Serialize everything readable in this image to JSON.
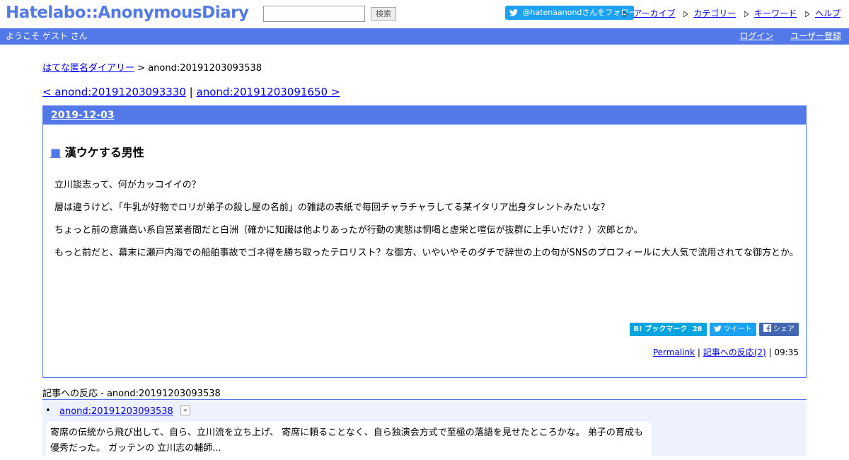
{
  "header": {
    "logo": "Hatelabo::AnonymousDiary",
    "search_placeholder": "",
    "search_button": "検索",
    "follow": "@hatenaanondさんをフォロー",
    "links": [
      "アーカイブ",
      "カテゴリー",
      "キーワード",
      "ヘルプ"
    ]
  },
  "subbar": {
    "welcome": "ようこそ ゲスト さん",
    "login": "ログイン",
    "register": "ユーザー登録"
  },
  "breadcrumb": {
    "home": "はてな匿名ダイアリー",
    "sep": " > ",
    "current": "anond:20191203093538"
  },
  "nav": {
    "prev": "< anond:20191203093330",
    "sep": " | ",
    "next": "anond:20191203091650 >"
  },
  "entry": {
    "date": "2019-12-03",
    "square": "■",
    "title": "漢ウケする男性",
    "paragraphs": [
      "立川談志って、何がカッコイイの？",
      "層は違うけど、「牛乳が好物でロリが弟子の殺し屋の名前」の雑誌の表紙で毎回チャラチャラしてる某イタリア出身タレントみたいな？",
      "ちょっと前の意識高い系自営業者間だと白洲（確かに知識は他よりあったが行動の実態は恫喝と虚栄と喧伝が抜群に上手いだけ？）次郎とか。",
      "もっと前だと、幕末に瀬戸内海での船舶事故でゴネ得を勝ち取ったテロリスト？な御方、いやいやそのダチで辞世の上の句がSNSのプロフィールに大人気で流用されてな御方とか。"
    ],
    "bookmark_label": "B! ブックマーク",
    "bookmark_count": "28",
    "tweet_label": "ツイート",
    "share_label": "シェア",
    "permalink": "Permalink",
    "reactions_link": "記事への反応(2)",
    "time": "09:35"
  },
  "reactions": {
    "header": "記事への反応 - anond:20191203093538",
    "item_link": "anond:20191203093538",
    "quote": "寄席の伝統から飛び出して、自ら、立川流を立ち上げ、 寄席に頼ることなく、自ら独演会方式で至極の落語を見せたところかな。 弟子の育成も優秀だった。 ガッテンの 立川志の輔師..."
  },
  "colors": {
    "brand": "#5279e7",
    "twitter": "#1da1f2",
    "hatena_bookmark": "#00a4de",
    "facebook": "#4267b2",
    "reaction_bg": "#edf2fd"
  }
}
